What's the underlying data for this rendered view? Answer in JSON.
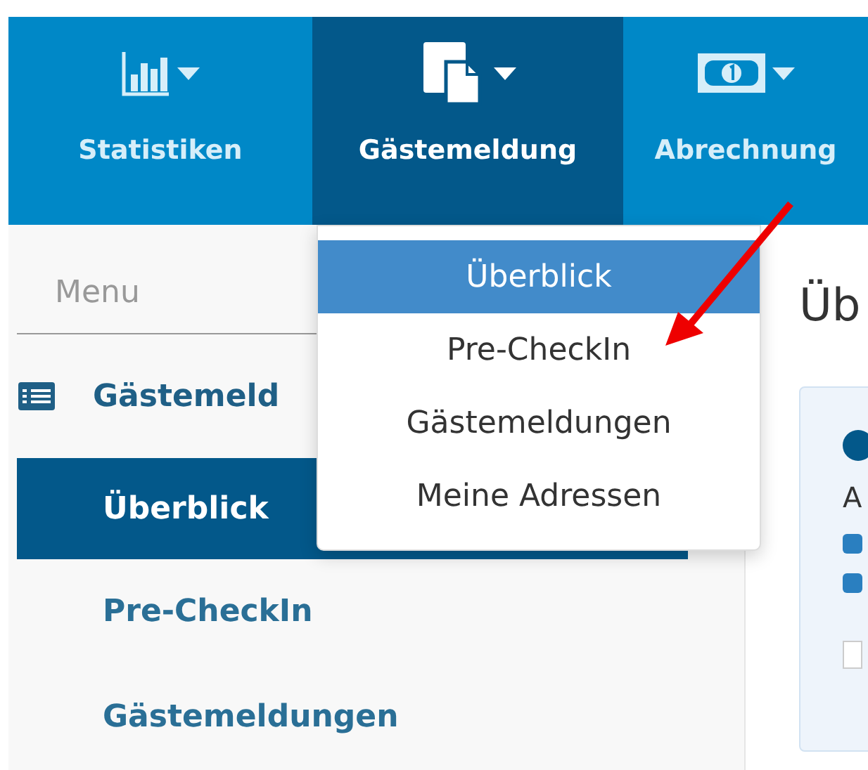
{
  "nav": {
    "items": [
      {
        "label": "Statistiken",
        "selected": false
      },
      {
        "label": "Gästemeldung",
        "selected": true
      },
      {
        "label": "Abrechnung",
        "selected": false
      }
    ]
  },
  "dropdown": {
    "items": [
      {
        "label": "Überblick",
        "selected": true
      },
      {
        "label": "Pre-CheckIn",
        "selected": false
      },
      {
        "label": "Gästemeldungen",
        "selected": false
      },
      {
        "label": "Meine Adressen",
        "selected": false
      }
    ]
  },
  "sidebar": {
    "title": "Menu",
    "section": "Gästemeld",
    "items": [
      {
        "label": "Überblick",
        "selected": true
      },
      {
        "label": "Pre-CheckIn",
        "selected": false
      },
      {
        "label": "Gästemeldungen",
        "selected": false
      }
    ]
  },
  "content": {
    "heading": "Üb",
    "card_text": "A"
  }
}
